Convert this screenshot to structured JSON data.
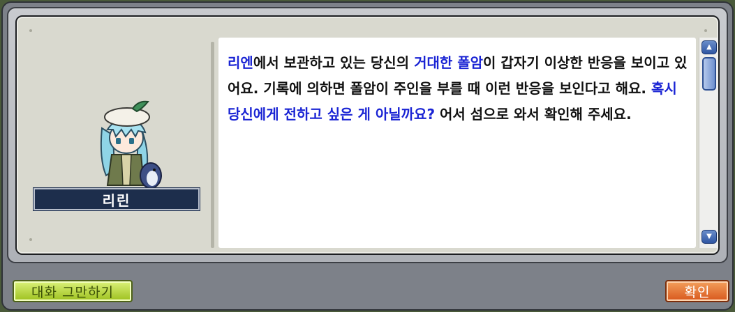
{
  "npc": {
    "name": "리린",
    "portrait_icon": "npc-portrait-icon"
  },
  "dialog": {
    "segments": [
      {
        "text": "리엔",
        "highlight": true
      },
      {
        "text": "에서 보관하고 있는 당신의 ",
        "highlight": false
      },
      {
        "text": "거대한 폴암",
        "highlight": true
      },
      {
        "text": "이 갑자기 이상한 반응을 보이고 있어요. 기록에 의하면 폴암이 주인을 부를 때 이런 반응을 보인다고 해요. ",
        "highlight": false
      },
      {
        "text": "혹시 당신에게 전하고 싶은 게 아닐까요?",
        "highlight": true
      },
      {
        "text": " 어서 섬으로 와서 확인해 주세요.",
        "highlight": false
      }
    ]
  },
  "buttons": {
    "end_chat": "대화 그만하기",
    "ok": "확인"
  },
  "scrollbar": {
    "up_icon": "scroll-up-icon",
    "down_icon": "scroll-down-icon"
  },
  "colors": {
    "highlight": "#1a24d4",
    "text": "#111111",
    "name_plate": "#1d2e4c",
    "end_button": "#9dc01e",
    "ok_button": "#d8571c"
  }
}
